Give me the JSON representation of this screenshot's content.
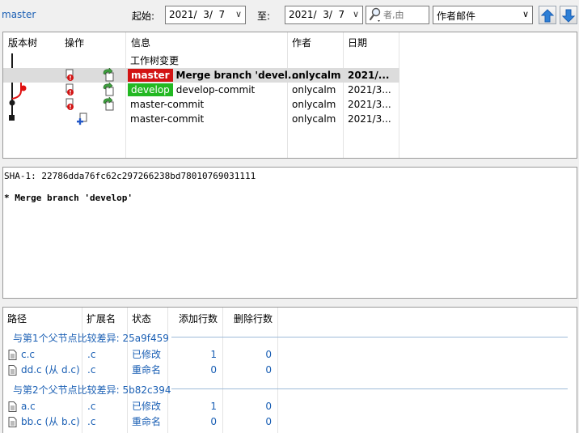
{
  "toolbar": {
    "branch": "master",
    "start_label": "起始:",
    "start_date": "2021/  3/  7",
    "end_label": "至:",
    "end_date": "2021/  3/  7",
    "search_placeholder": "者,由",
    "search_field": "作者邮件",
    "up_arrow": "arrow-up-icon",
    "down_arrow": "arrow-down-icon",
    "accent": "#1a5fb4"
  },
  "log": {
    "columns": [
      "版本树",
      "操作",
      "信息",
      "作者",
      "日期"
    ],
    "rows": [
      {
        "message": "工作树变更",
        "author": "",
        "date": "",
        "tag": "",
        "tag_color": "",
        "has_ops": false,
        "selected": false,
        "bold": false
      },
      {
        "message": "Merge branch 'devel...",
        "author": "onlycalm",
        "date": "2021/...",
        "tag": "master",
        "tag_color": "#d21414",
        "has_ops": true,
        "selected": true,
        "bold": true
      },
      {
        "message": "develop-commit",
        "author": "onlycalm",
        "date": "2021/3...",
        "tag": "develop",
        "tag_color": "#22b822",
        "has_ops": true,
        "selected": false,
        "bold": false
      },
      {
        "message": "master-commit",
        "author": "onlycalm",
        "date": "2021/3...",
        "tag": "",
        "tag_color": "",
        "has_ops": true,
        "selected": false,
        "bold": false
      },
      {
        "message": "master-commit",
        "author": "onlycalm",
        "date": "2021/3...",
        "tag": "",
        "tag_color": "",
        "has_ops": false,
        "selected": false,
        "bold": false
      }
    ]
  },
  "details": {
    "sha_line": "SHA-1: 22786dda76fc62c297266238bd78010769031111",
    "message_line": "* Merge branch 'develop'"
  },
  "changes": {
    "columns": [
      "路径",
      "扩展名",
      "状态",
      "添加行数",
      "删除行数"
    ],
    "groups": [
      {
        "title": "与第1个父节点比较差异: 25a9f459",
        "files": [
          {
            "path": "c.c",
            "ext": ".c",
            "status": "已修改",
            "added": "1",
            "deleted": "0"
          },
          {
            "path": "dd.c (从 d.c)",
            "ext": ".c",
            "status": "重命名",
            "added": "0",
            "deleted": "0"
          }
        ]
      },
      {
        "title": "与第2个父节点比较差异: 5b82c394",
        "files": [
          {
            "path": "a.c",
            "ext": ".c",
            "status": "已修改",
            "added": "1",
            "deleted": "0"
          },
          {
            "path": "bb.c (从 b.c)",
            "ext": ".c",
            "status": "重命名",
            "added": "0",
            "deleted": "0"
          }
        ]
      }
    ]
  }
}
